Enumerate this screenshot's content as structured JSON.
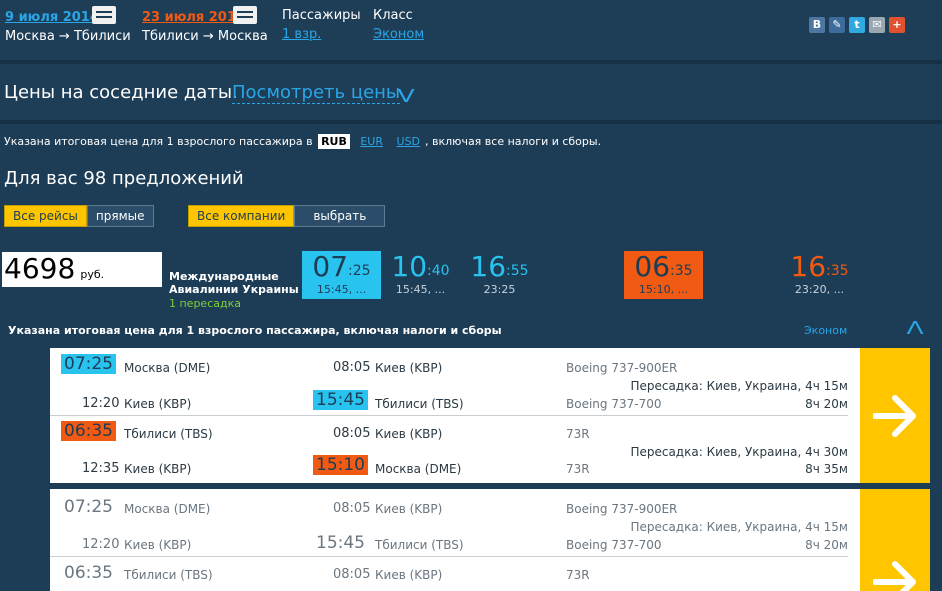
{
  "header": {
    "outbound": {
      "date": "9 июля 2014",
      "route": "Москва → Тбилиси",
      "color": "#2aa6e6"
    },
    "inbound": {
      "date": "23 июля 2014",
      "route": "Тбилиси → Москва",
      "color": "#f15a12"
    },
    "passengers_label": "Пассажиры",
    "passengers_value": "1 взр.",
    "class_label": "Класс",
    "class_value": "Эконом",
    "social": [
      {
        "icon": "vk-icon",
        "glyph": "В",
        "color": "#4d76a1"
      },
      {
        "icon": "livejournal-icon",
        "glyph": "✎",
        "color": "#3d6b9c"
      },
      {
        "icon": "twitter-icon",
        "glyph": "t",
        "color": "#2fa9e0"
      },
      {
        "icon": "mail-icon",
        "glyph": "✉",
        "color": "#9aa7b1"
      },
      {
        "icon": "google-plus-icon",
        "glyph": "+",
        "color": "#e0512f"
      }
    ]
  },
  "neighbor": {
    "title": "Цены на соседние даты.",
    "link": "Посмотреть цены"
  },
  "price_note": {
    "before": "Указана итоговая цена для 1 взрослого пассажира в",
    "currencies": [
      "RUB",
      "EUR",
      "USD"
    ],
    "active_currency": "RUB",
    "after": ", включая все налоги и сборы."
  },
  "offers_count_text": "Для вас 98 предложений",
  "filters": {
    "flights": {
      "all": "Все рейсы",
      "direct": "прямые"
    },
    "companies": {
      "all": "Все компании",
      "choose": "выбрать"
    }
  },
  "offer": {
    "price": "4698",
    "currency": "руб.",
    "airline_line1": "Международные",
    "airline_line2": "Авиалинии Украины",
    "stops": "1 пересадка",
    "times": [
      {
        "h": "07",
        "m": ":25",
        "sub": "15:45, ..."
      },
      {
        "h": "10",
        "m": ":40",
        "sub": "15:45, ..."
      },
      {
        "h": "16",
        "m": ":55",
        "sub": "23:25"
      },
      {
        "h": "06",
        "m": ":35",
        "sub": "15:10, ..."
      },
      {
        "h": "16",
        "m": ":35",
        "sub": "23:20, ..."
      }
    ]
  },
  "detail": {
    "note": "Указана итоговая цена для 1 взрослого пассажира, включая налоги и сборы",
    "class_link": "Эконом"
  },
  "cards": [
    {
      "legs": [
        {
          "dep1": "07:25",
          "from1": "Москва (DME)",
          "arr1": "08:05",
          "to1": "Киев (KBP)",
          "plane1": "Boeing 737-900ER",
          "transfer": "Пересадка: Киев, Украина, 4ч 15м",
          "dep2": "12:20",
          "from2": "Киев (KBP)",
          "arr2": "15:45",
          "to2": "Тбилиси (TBS)",
          "plane2": "Boeing 737-700",
          "total": "8ч 20м"
        },
        {
          "dep1": "06:35",
          "from1": "Тбилиси (TBS)",
          "arr1": "08:05",
          "to1": "Киев (KBP)",
          "plane1": "73R",
          "transfer": "Пересадка: Киев, Украина, 4ч 30м",
          "dep2": "12:35",
          "from2": "Киев (KBP)",
          "arr2": "15:10",
          "to2": "Москва (DME)",
          "plane2": "73R",
          "total": "8ч 35м"
        }
      ]
    },
    {
      "legs": [
        {
          "dep1": "07:25",
          "from1": "Москва (DME)",
          "arr1": "08:05",
          "to1": "Киев (KBP)",
          "plane1": "Boeing 737-900ER",
          "transfer": "Пересадка: Киев, Украина, 4ч 15м",
          "dep2": "12:20",
          "from2": "Киев (KBP)",
          "arr2": "15:45",
          "to2": "Тбилиси (TBS)",
          "plane2": "Boeing 737-700",
          "total": "8ч 20м"
        },
        {
          "dep1": "06:35",
          "from1": "Тбилиси (TBS)",
          "arr1": "08:05",
          "to1": "Киев (KBP)",
          "plane1": "73R"
        }
      ]
    }
  ]
}
